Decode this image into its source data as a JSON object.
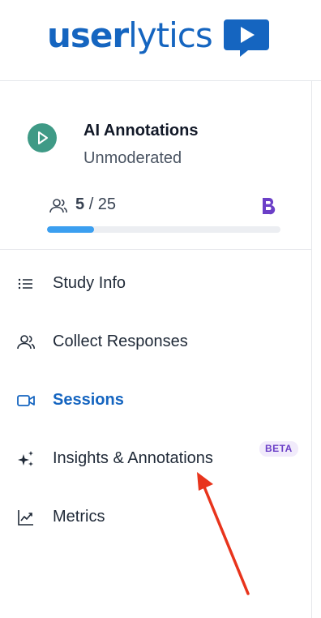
{
  "brand": {
    "logo_bold": "user",
    "logo_light": "lytics",
    "logo_icon": "play-speech-bubble-icon",
    "color": "#1565c0"
  },
  "study": {
    "title": "AI Annotations",
    "type": "Unmoderated",
    "icon": "play-icon",
    "participants_current": "5",
    "participants_total": "/ 25",
    "progress_fraction": 0.2,
    "progress_color": "#3b9ff0",
    "brand_badge_icon": "b-logo-icon"
  },
  "nav": {
    "items": [
      {
        "label": "Study Info",
        "icon": "list-icon",
        "active": false
      },
      {
        "label": "Collect Responses",
        "icon": "participants-icon",
        "active": false
      },
      {
        "label": "Sessions",
        "icon": "video-camera-icon",
        "active": true
      },
      {
        "label": "Insights & Annotations",
        "icon": "sparkles-icon",
        "active": false,
        "badge": "BETA"
      },
      {
        "label": "Metrics",
        "icon": "chart-line-icon",
        "active": false
      }
    ]
  },
  "colors": {
    "active": "#1565c0",
    "badge_bg": "#f1ebfb",
    "badge_text": "#6b3fc7",
    "arrow": "#e8341c",
    "study_icon_bg": "#3f9a86"
  }
}
